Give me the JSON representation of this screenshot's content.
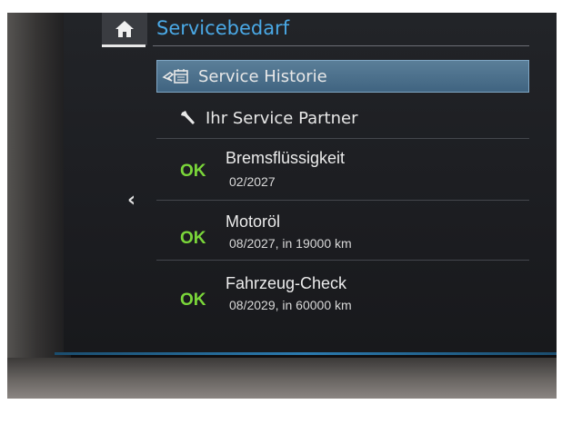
{
  "header": {
    "title": "Servicebedarf",
    "home_icon": "home-icon",
    "back_icon": "chevron-left-icon"
  },
  "menu": {
    "items": [
      {
        "label": "Service Historie",
        "icon": "service-history-icon",
        "selected": true
      },
      {
        "label": "Ihr Service Partner",
        "icon": "wrench-icon",
        "selected": false
      }
    ]
  },
  "services": [
    {
      "status": "OK",
      "name": "Bremsflüssigkeit",
      "detail": "02/2027"
    },
    {
      "status": "OK",
      "name": "Motoröl",
      "detail": "08/2027, in 19000 km"
    },
    {
      "status": "OK",
      "name": "Fahrzeug-Check",
      "detail": "08/2029, in 60000 km"
    }
  ],
  "colors": {
    "accent": "#4aa9e6",
    "ok": "#7ad63a",
    "selected": "#4f7390"
  }
}
